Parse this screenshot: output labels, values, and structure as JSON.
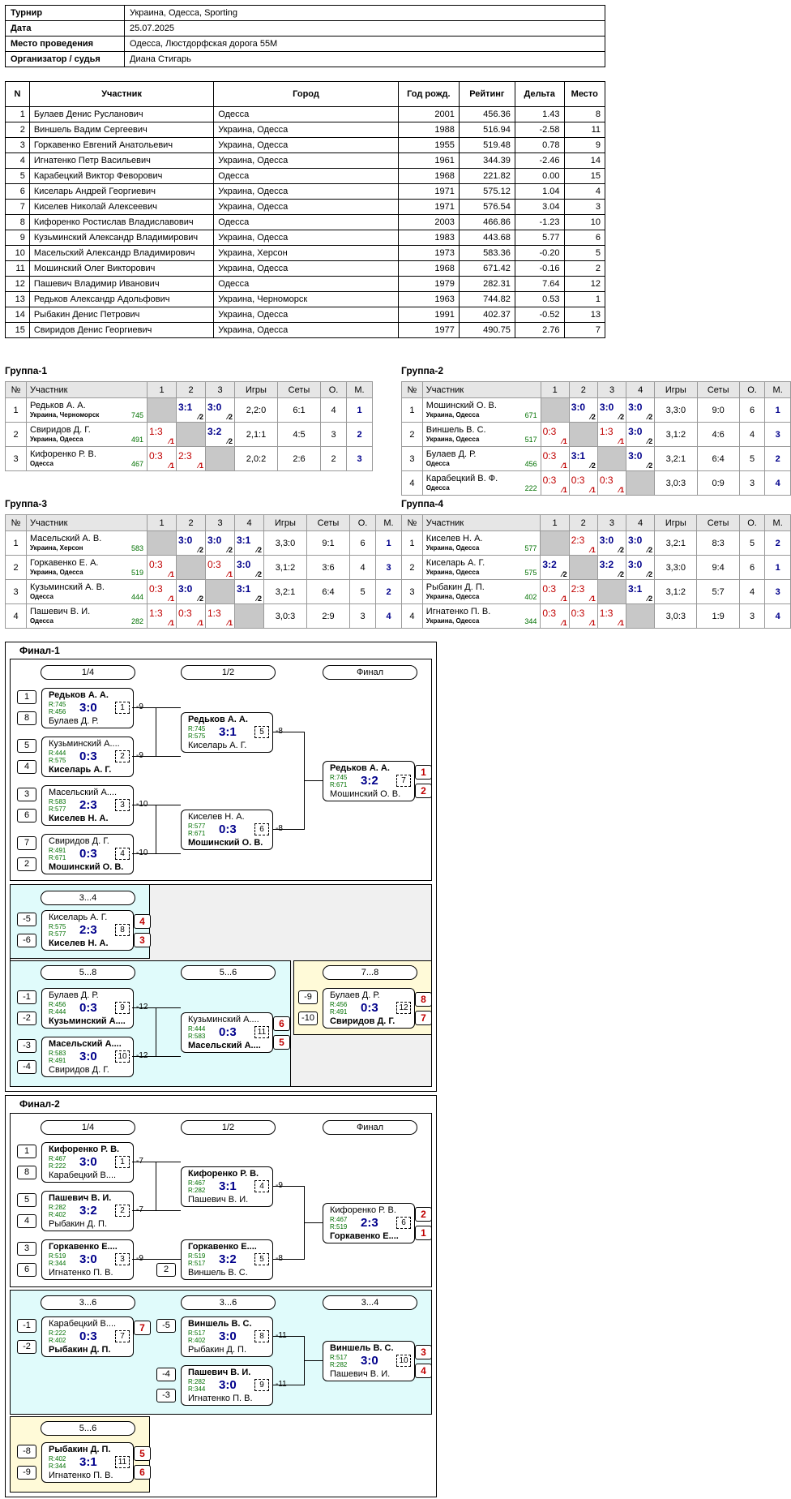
{
  "info": [
    {
      "k": "Турнир",
      "v": "Украина, Одесса, Sporting"
    },
    {
      "k": "Дата",
      "v": "25.07.2025"
    },
    {
      "k": "Место проведения",
      "v": "Одесса, Люстдорфская дорога 55М"
    },
    {
      "k": "Организатор / судья",
      "v": "Диана Стигарь"
    }
  ],
  "players_header": [
    "N",
    "Участник",
    "Город",
    "Год рожд.",
    "Рейтинг",
    "Дельта",
    "Место"
  ],
  "players": [
    [
      "1",
      "Булаев Денис Русланович",
      "Одесса",
      "2001",
      "456.36",
      "1.43",
      "8"
    ],
    [
      "2",
      "Виншель Вадим Сергеевич",
      "Украина, Одесса",
      "1988",
      "516.94",
      "-2.58",
      "11"
    ],
    [
      "3",
      "Горкавенко Евгений Анатольевич",
      "Украина, Одесса",
      "1955",
      "519.48",
      "0.78",
      "9"
    ],
    [
      "4",
      "Игнатенко Петр Васильевич",
      "Украина, Одесса",
      "1961",
      "344.39",
      "-2.46",
      "14"
    ],
    [
      "5",
      "Карабецкий Виктор Февoрович",
      "Одесса",
      "1968",
      "221.82",
      "0.00",
      "15"
    ],
    [
      "6",
      "Киселарь Андрей Георгиевич",
      "Украина, Одесса",
      "1971",
      "575.12",
      "1.04",
      "4"
    ],
    [
      "7",
      "Киселев Николай Алексеевич",
      "Украина, Одесса",
      "1971",
      "576.54",
      "3.04",
      "3"
    ],
    [
      "8",
      "Кифоренко Ростислав Владиславович",
      "Одесса",
      "2003",
      "466.86",
      "-1.23",
      "10"
    ],
    [
      "9",
      "Кузьминский Александр Владимирович",
      "Украина, Одесса",
      "1983",
      "443.68",
      "5.77",
      "6"
    ],
    [
      "10",
      "Масельский Александр Владимирович",
      "Украина, Херсон",
      "1973",
      "583.36",
      "-0.20",
      "5"
    ],
    [
      "11",
      "Мошинский Олег Викторович",
      "Украина, Одесса",
      "1968",
      "671.42",
      "-0.16",
      "2"
    ],
    [
      "12",
      "Пашевич Владимир Иванович",
      "Одесса",
      "1979",
      "282.31",
      "7.64",
      "12"
    ],
    [
      "13",
      "Редьков Александр Адольфович",
      "Украина, Черноморск",
      "1963",
      "744.82",
      "0.53",
      "1"
    ],
    [
      "14",
      "Рыбакин Денис Петрович",
      "Украина, Одесса",
      "1991",
      "402.37",
      "-0.52",
      "13"
    ],
    [
      "15",
      "Свиридов Денис Георгиевич",
      "Украина, Одесса",
      "1977",
      "490.75",
      "2.76",
      "7"
    ]
  ],
  "group_header": {
    "no": "№",
    "name": "Участник",
    "games": "Игры",
    "sets": "Сеты",
    "pts": "О.",
    "place": "М."
  },
  "groups": [
    {
      "title": "Группа-1",
      "players": [
        {
          "n": "1",
          "name": "Редьков А. А.",
          "city": "Украина, Черноморск",
          "r": "745",
          "cells": [
            "x",
            "3:1|2",
            "3:0|2"
          ],
          "games": "2,2:0",
          "sets": "6:1",
          "pts": "4",
          "place": "1"
        },
        {
          "n": "2",
          "name": "Свиридов Д. Г.",
          "city": "Украина, Одесса",
          "r": "491",
          "cells": [
            "1:3|1",
            "x",
            "3:2|2"
          ],
          "games": "2,1:1",
          "sets": "4:5",
          "pts": "3",
          "place": "2"
        },
        {
          "n": "3",
          "name": "Кифоренко Р. В.",
          "city": "Одесса",
          "r": "467",
          "cells": [
            "0:3|1",
            "2:3|1",
            "x"
          ],
          "games": "2,0:2",
          "sets": "2:6",
          "pts": "2",
          "place": "3"
        }
      ]
    },
    {
      "title": "Группа-2",
      "players": [
        {
          "n": "1",
          "name": "Мошинский О. В.",
          "city": "Украина, Одесса",
          "r": "671",
          "cells": [
            "x",
            "3:0|2",
            "3:0|2",
            "3:0|2"
          ],
          "games": "3,3:0",
          "sets": "9:0",
          "pts": "6",
          "place": "1"
        },
        {
          "n": "2",
          "name": "Виншель В. С.",
          "city": "Украина, Одесса",
          "r": "517",
          "cells": [
            "0:3|1",
            "x",
            "1:3|1",
            "3:0|2"
          ],
          "games": "3,1:2",
          "sets": "4:6",
          "pts": "4",
          "place": "3"
        },
        {
          "n": "3",
          "name": "Булаев Д. Р.",
          "city": "Одесса",
          "r": "456",
          "cells": [
            "0:3|1",
            "3:1|2",
            "x",
            "3:0|2"
          ],
          "games": "3,2:1",
          "sets": "6:4",
          "pts": "5",
          "place": "2"
        },
        {
          "n": "4",
          "name": "Карабецкий В. Ф.",
          "city": "Одесса",
          "r": "222",
          "cells": [
            "0:3|1",
            "0:3|1",
            "0:3|1",
            "x"
          ],
          "games": "3,0:3",
          "sets": "0:9",
          "pts": "3",
          "place": "4"
        }
      ]
    },
    {
      "title": "Группа-3",
      "players": [
        {
          "n": "1",
          "name": "Масельский А. В.",
          "city": "Украина, Херсон",
          "r": "583",
          "cells": [
            "x",
            "3:0|2",
            "3:0|2",
            "3:1|2"
          ],
          "games": "3,3:0",
          "sets": "9:1",
          "pts": "6",
          "place": "1"
        },
        {
          "n": "2",
          "name": "Горкавенко Е. А.",
          "city": "Украина, Одесса",
          "r": "519",
          "cells": [
            "0:3|1",
            "x",
            "0:3|1",
            "3:0|2"
          ],
          "games": "3,1:2",
          "sets": "3:6",
          "pts": "4",
          "place": "3"
        },
        {
          "n": "3",
          "name": "Кузьминский А. В.",
          "city": "Одесса",
          "r": "444",
          "cells": [
            "0:3|1",
            "3:0|2",
            "x",
            "3:1|2"
          ],
          "games": "3,2:1",
          "sets": "6:4",
          "pts": "5",
          "place": "2"
        },
        {
          "n": "4",
          "name": "Пашевич В. И.",
          "city": "Одесса",
          "r": "282",
          "cells": [
            "1:3|1",
            "0:3|1",
            "1:3|1",
            "x"
          ],
          "games": "3,0:3",
          "sets": "2:9",
          "pts": "3",
          "place": "4"
        }
      ]
    },
    {
      "title": "Группа-4",
      "players": [
        {
          "n": "1",
          "name": "Киселев Н. А.",
          "city": "Украина, Одесса",
          "r": "577",
          "cells": [
            "x",
            "2:3|1",
            "3:0|2",
            "3:0|2"
          ],
          "games": "3,2:1",
          "sets": "8:3",
          "pts": "5",
          "place": "2"
        },
        {
          "n": "2",
          "name": "Киселарь А. Г.",
          "city": "Украина, Одесса",
          "r": "575",
          "cells": [
            "3:2|2",
            "x",
            "3:2|2",
            "3:0|2"
          ],
          "games": "3,3:0",
          "sets": "9:4",
          "pts": "6",
          "place": "1"
        },
        {
          "n": "3",
          "name": "Рыбакин Д. П.",
          "city": "Украина, Одесса",
          "r": "402",
          "cells": [
            "0:3|1",
            "2:3|1",
            "x",
            "3:1|2"
          ],
          "games": "3,1:2",
          "sets": "5:7",
          "pts": "4",
          "place": "3"
        },
        {
          "n": "4",
          "name": "Игнатенко П. В.",
          "city": "Украина, Одесса",
          "r": "344",
          "cells": [
            "0:3|1",
            "0:3|1",
            "1:3|1",
            "x"
          ],
          "games": "3,0:3",
          "sets": "1:9",
          "pts": "3",
          "place": "4"
        }
      ]
    }
  ],
  "final1": {
    "title": "Финал-1",
    "labels": {
      "q": "1/4",
      "s": "1/2",
      "f": "Финал",
      "p34": "3...4",
      "p58": "5...8",
      "p56": "5...6",
      "p78": "7...8"
    },
    "matches": [
      {
        "n1": "Редьков А. А.",
        "n2": "Булаев Д. Р.",
        "r1": "R:745",
        "r2": "R:456",
        "s": "3:0",
        "m": "1",
        "w": 1,
        "out": "-9",
        "s1": "1",
        "s2": "8"
      },
      {
        "n1": "Кузьминский А....",
        "n2": "Киселарь А. Г.",
        "r1": "R:444",
        "r2": "R:575",
        "s": "0:3",
        "m": "2",
        "w": 2,
        "out": "-9",
        "s1": "5",
        "s2": "4"
      },
      {
        "n1": "Масельский А....",
        "n2": "Киселев Н. А.",
        "r1": "R:583",
        "r2": "R:577",
        "s": "2:3",
        "m": "3",
        "w": 2,
        "out": "-10",
        "s1": "3",
        "s2": "6"
      },
      {
        "n1": "Свиридов Д. Г.",
        "n2": "Мошинский О. В.",
        "r1": "R:491",
        "r2": "R:671",
        "s": "0:3",
        "m": "4",
        "w": 2,
        "out": "-10",
        "s1": "7",
        "s2": "2"
      },
      {
        "n1": "Редьков А. А.",
        "n2": "Киселарь А. Г.",
        "r1": "R:745",
        "r2": "R:575",
        "s": "3:1",
        "m": "5",
        "w": 1,
        "out": "-8"
      },
      {
        "n1": "Киселев Н. А.",
        "n2": "Мошинский О. В.",
        "r1": "R:577",
        "r2": "R:671",
        "s": "0:3",
        "m": "6",
        "w": 2,
        "out": "-8"
      },
      {
        "n1": "Редьков А. А.",
        "n2": "Мошинский О. В.",
        "r1": "R:745",
        "r2": "R:671",
        "s": "3:2",
        "m": "7",
        "w": 1,
        "p1": "1",
        "p2": "2"
      },
      {
        "n1": "Киселарь А. Г.",
        "n2": "Киселев Н. А.",
        "r1": "R:575",
        "r2": "R:577",
        "s": "2:3",
        "m": "8",
        "w": 2,
        "p1": "4",
        "p2": "3",
        "s1": "-5",
        "s2": "-6"
      },
      {
        "n1": "Булаев Д. Р.",
        "n2": "Кузьминский А....",
        "r1": "R:456",
        "r2": "R:444",
        "s": "0:3",
        "m": "9",
        "w": 2,
        "out": "-12",
        "s1": "-1",
        "s2": "-2"
      },
      {
        "n1": "Масельский А....",
        "n2": "Свиридов Д. Г.",
        "r1": "R:583",
        "r2": "R:491",
        "s": "3:0",
        "m": "10",
        "w": 1,
        "out": "-12",
        "s1": "-3",
        "s2": "-4"
      },
      {
        "n1": "Кузьминский А....",
        "n2": "Масельский А....",
        "r1": "R:444",
        "r2": "R:583",
        "s": "0:3",
        "m": "11",
        "w": 2,
        "p1": "6",
        "p2": "5"
      },
      {
        "n1": "Булаев Д. Р.",
        "n2": "Свиридов Д. Г.",
        "r1": "R:456",
        "r2": "R:491",
        "s": "0:3",
        "m": "12",
        "w": 2,
        "p1": "8",
        "p2": "7",
        "s1": "-9",
        "s2": "-10"
      }
    ]
  },
  "final2": {
    "title": "Финал-2",
    "labels": {
      "q": "1/4",
      "s": "1/2",
      "f": "Финал",
      "p36a": "3...6",
      "p36b": "3...6",
      "p34": "3...4",
      "p56": "5...6"
    },
    "matches": [
      {
        "n1": "Кифоренко Р. В.",
        "n2": "Карабецкий В....",
        "r1": "R:467",
        "r2": "R:222",
        "s": "3:0",
        "m": "1",
        "w": 1,
        "out": "-7",
        "s1": "1",
        "s2": "8"
      },
      {
        "n1": "Пашевич В. И.",
        "n2": "Рыбакин Д. П.",
        "r1": "R:282",
        "r2": "R:402",
        "s": "3:2",
        "m": "2",
        "w": 1,
        "out": "-7",
        "s1": "5",
        "s2": "4"
      },
      {
        "n1": "Горкавенко Е....",
        "n2": "Игнатенко П. В.",
        "r1": "R:519",
        "r2": "R:344",
        "s": "3:0",
        "m": "3",
        "w": 1,
        "out": "-9",
        "s1": "3",
        "s2": "6"
      },
      {
        "n1": "Кифоренко Р. В.",
        "n2": "Пашевич В. И.",
        "r1": "R:467",
        "r2": "R:282",
        "s": "3:1",
        "m": "4",
        "w": 1,
        "out": "-9"
      },
      {
        "n1": "Горкавенко Е....",
        "n2": "Виншель В. С.",
        "r1": "R:519",
        "r2": "R:517",
        "s": "3:2",
        "m": "5",
        "w": 1,
        "out": "-8",
        "s2": "2"
      },
      {
        "n1": "Кифоренко Р. В.",
        "n2": "Горкавенко Е....",
        "r1": "R:467",
        "r2": "R:519",
        "s": "2:3",
        "m": "6",
        "w": 2,
        "p1": "2",
        "p2": "1"
      },
      {
        "n1": "Карабецкий В....",
        "n2": "Рыбакин Д. П.",
        "r1": "R:222",
        "r2": "R:402",
        "s": "0:3",
        "m": "7",
        "w": 2,
        "p1": "7",
        "s1": "-1",
        "s2": "-2"
      },
      {
        "n1": "Виншель В. С.",
        "n2": "Рыбакин Д. П.",
        "r1": "R:517",
        "r2": "R:402",
        "s": "3:0",
        "m": "8",
        "w": 1,
        "out": "-11",
        "s1": "-5"
      },
      {
        "n1": "Пашевич В. И.",
        "n2": "Игнатенко П. В.",
        "r1": "R:282",
        "r2": "R:344",
        "s": "3:0",
        "m": "9",
        "w": 1,
        "out": "-11",
        "s1": "-4",
        "s2": "-3"
      },
      {
        "n1": "Виншель В. С.",
        "n2": "Пашевич В. И.",
        "r1": "R:517",
        "r2": "R:282",
        "s": "3:0",
        "m": "10",
        "w": 1,
        "p1": "3",
        "p2": "4"
      },
      {
        "n1": "Рыбакин Д. П.",
        "n2": "Игнатенко П. В.",
        "r1": "R:402",
        "r2": "R:344",
        "s": "3:1",
        "m": "11",
        "w": 1,
        "p1": "5",
        "p2": "6",
        "s1": "-8",
        "s2": "-9"
      }
    ]
  }
}
